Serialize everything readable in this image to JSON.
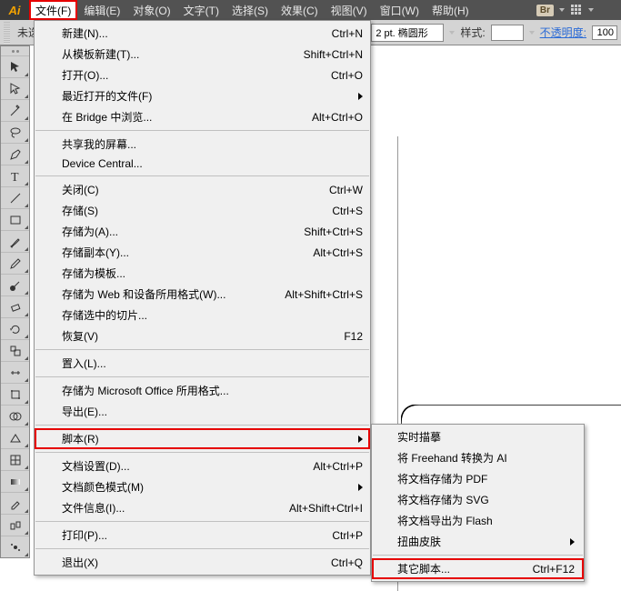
{
  "app": {
    "logo": "Ai"
  },
  "menubar": {
    "items": [
      {
        "label": "文件(F)",
        "active": true
      },
      {
        "label": "编辑(E)"
      },
      {
        "label": "对象(O)"
      },
      {
        "label": "文字(T)"
      },
      {
        "label": "选择(S)"
      },
      {
        "label": "效果(C)"
      },
      {
        "label": "视图(V)"
      },
      {
        "label": "窗口(W)"
      },
      {
        "label": "帮助(H)"
      }
    ]
  },
  "header": {
    "br_badge": "Br"
  },
  "options": {
    "left_text": "未选",
    "stroke_value": "2 pt. 椭圆形",
    "style_label": "样式:",
    "opacity_label": "不透明度:",
    "opacity_value": "100"
  },
  "file_menu": [
    {
      "type": "item",
      "label": "新建(N)...",
      "shortcut": "Ctrl+N"
    },
    {
      "type": "item",
      "label": "从模板新建(T)...",
      "shortcut": "Shift+Ctrl+N"
    },
    {
      "type": "item",
      "label": "打开(O)...",
      "shortcut": "Ctrl+O"
    },
    {
      "type": "item",
      "label": "最近打开的文件(F)",
      "submenu": true
    },
    {
      "type": "item",
      "label": "在 Bridge 中浏览...",
      "shortcut": "Alt+Ctrl+O"
    },
    {
      "type": "sep"
    },
    {
      "type": "item",
      "label": "共享我的屏幕..."
    },
    {
      "type": "item",
      "label": "Device Central..."
    },
    {
      "type": "sep"
    },
    {
      "type": "item",
      "label": "关闭(C)",
      "shortcut": "Ctrl+W"
    },
    {
      "type": "item",
      "label": "存储(S)",
      "shortcut": "Ctrl+S"
    },
    {
      "type": "item",
      "label": "存储为(A)...",
      "shortcut": "Shift+Ctrl+S"
    },
    {
      "type": "item",
      "label": "存储副本(Y)...",
      "shortcut": "Alt+Ctrl+S"
    },
    {
      "type": "item",
      "label": "存储为模板..."
    },
    {
      "type": "item",
      "label": "存储为 Web 和设备所用格式(W)...",
      "shortcut": "Alt+Shift+Ctrl+S"
    },
    {
      "type": "item",
      "label": "存储选中的切片..."
    },
    {
      "type": "item",
      "label": "恢复(V)",
      "shortcut": "F12"
    },
    {
      "type": "sep"
    },
    {
      "type": "item",
      "label": "置入(L)..."
    },
    {
      "type": "sep"
    },
    {
      "type": "item",
      "label": "存储为 Microsoft Office 所用格式..."
    },
    {
      "type": "item",
      "label": "导出(E)..."
    },
    {
      "type": "sep"
    },
    {
      "type": "item",
      "label": "脚本(R)",
      "submenu": true,
      "highlighted": true
    },
    {
      "type": "sep"
    },
    {
      "type": "item",
      "label": "文档设置(D)...",
      "shortcut": "Alt+Ctrl+P"
    },
    {
      "type": "item",
      "label": "文档颜色模式(M)",
      "submenu": true
    },
    {
      "type": "item",
      "label": "文件信息(I)...",
      "shortcut": "Alt+Shift+Ctrl+I"
    },
    {
      "type": "sep"
    },
    {
      "type": "item",
      "label": "打印(P)...",
      "shortcut": "Ctrl+P"
    },
    {
      "type": "sep"
    },
    {
      "type": "item",
      "label": "退出(X)",
      "shortcut": "Ctrl+Q"
    }
  ],
  "script_submenu": [
    {
      "type": "item",
      "label": "实时描摹"
    },
    {
      "type": "item",
      "label": "将 Freehand 转换为 AI"
    },
    {
      "type": "item",
      "label": "将文档存储为 PDF"
    },
    {
      "type": "item",
      "label": "将文档存储为 SVG"
    },
    {
      "type": "item",
      "label": "将文档导出为 Flash"
    },
    {
      "type": "item",
      "label": "扭曲皮肤",
      "submenu": true
    },
    {
      "type": "sep"
    },
    {
      "type": "item",
      "label": "其它脚本...",
      "shortcut": "Ctrl+F12",
      "highlighted": true
    }
  ],
  "tools": [
    "selection",
    "direct-select",
    "wand",
    "lasso",
    "pen",
    "type",
    "line",
    "rect",
    "brush",
    "pencil",
    "blob",
    "eraser",
    "rotate",
    "scale",
    "width",
    "free",
    "shape-builder",
    "perspective",
    "mesh",
    "gradient",
    "eyedrop",
    "blend",
    "symbol",
    "graph",
    "artboard",
    "slice",
    "hand",
    "zoom"
  ]
}
